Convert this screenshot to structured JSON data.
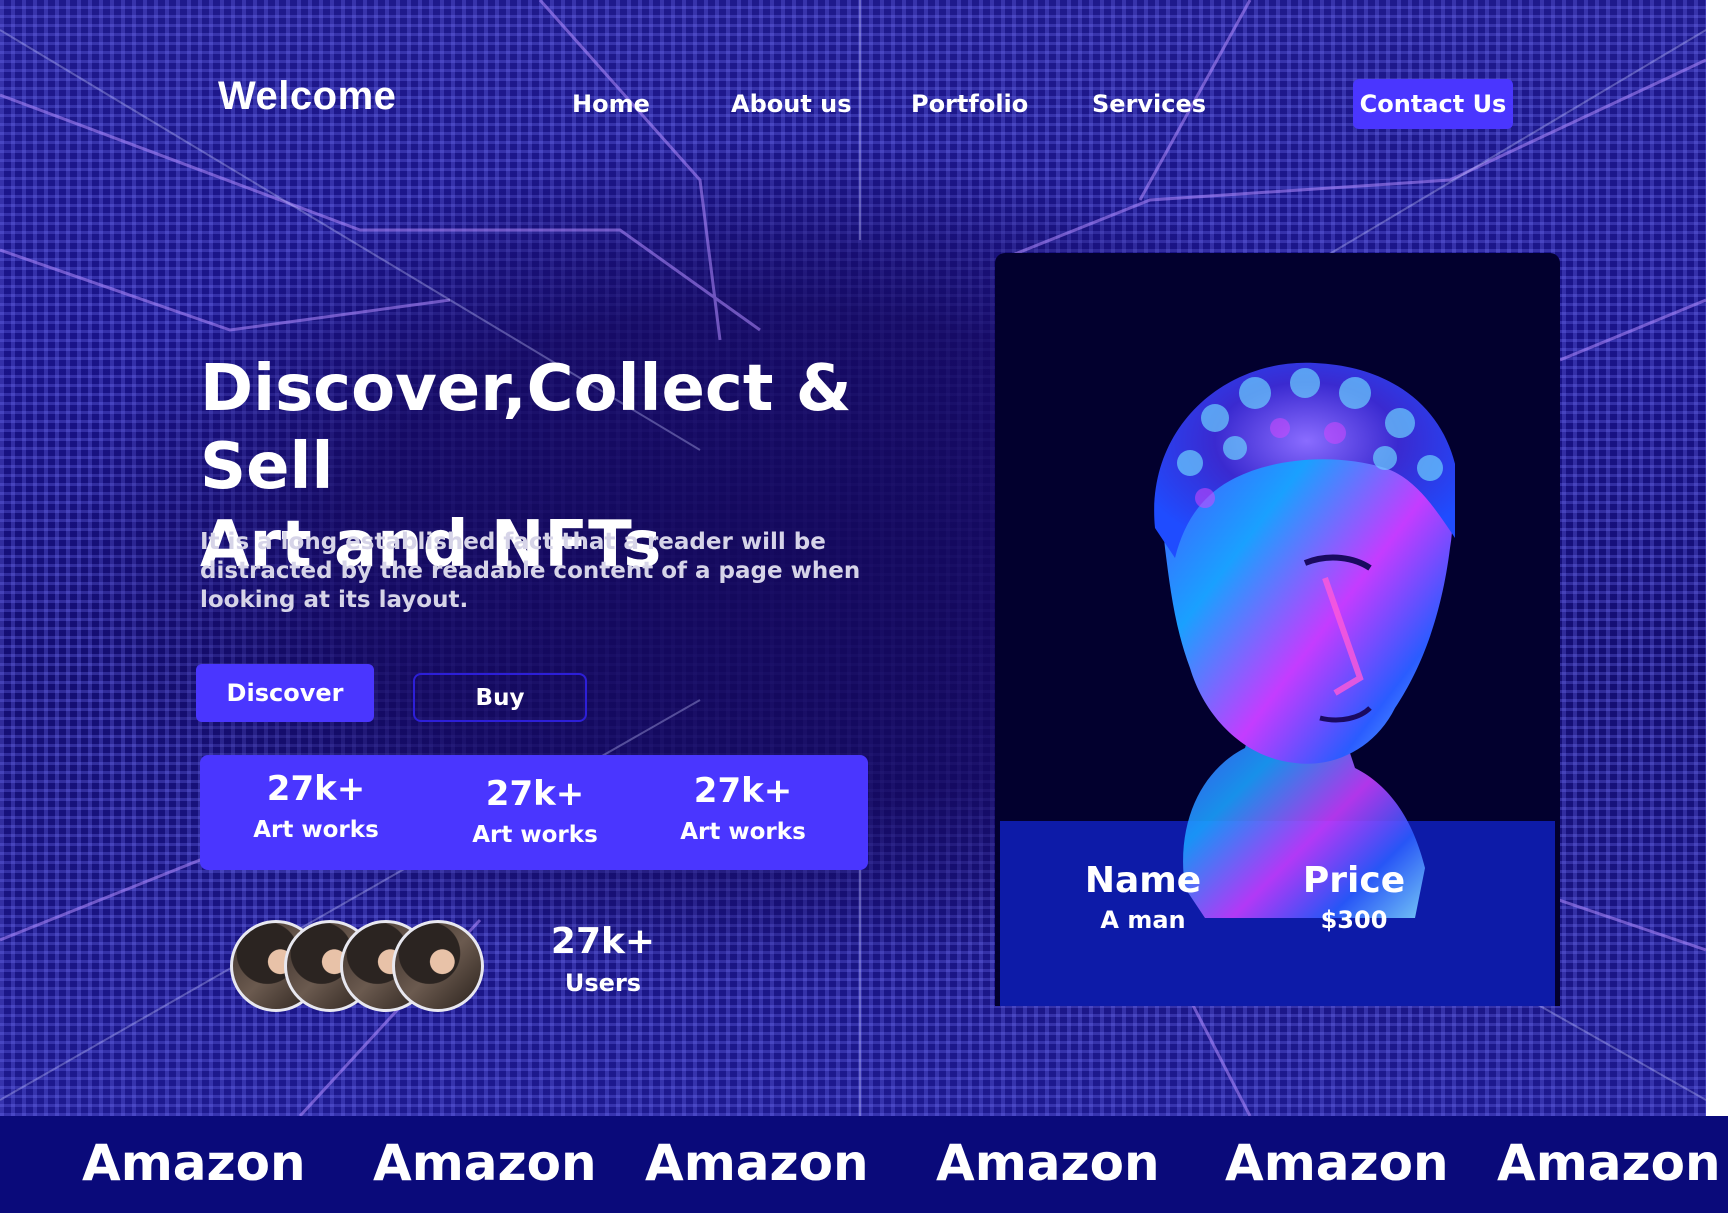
{
  "nav": {
    "logo": "Welcome",
    "links": [
      "Home",
      "About us",
      "Portfolio",
      "Services"
    ],
    "cta": "Contact Us"
  },
  "hero": {
    "headline_line1": "Discover,Collect & Sell",
    "headline_line2": "Art and NFTs",
    "subtext": "It is a long established fact that a reader will be distracted by the readable content of a page when looking at its layout.",
    "primary_button": "Discover",
    "secondary_button": "Buy"
  },
  "stats": [
    {
      "value": "27k+",
      "label": "Art works"
    },
    {
      "value": "27k+",
      "label": "Art works"
    },
    {
      "value": "27k+",
      "label": "Art works"
    }
  ],
  "users": {
    "value": "27k+",
    "label": "Users"
  },
  "card": {
    "name_heading": "Name",
    "name_value": "A man",
    "price_heading": "Price",
    "price_value": "$300"
  },
  "brands": [
    "Amazon",
    "Amazon",
    "Amazon",
    "Amazon",
    "Amazon",
    "Amazon"
  ],
  "colors": {
    "accent": "#4a36ff",
    "ticker_bg": "#0a0a7a",
    "card_bg": "#02002e",
    "card_info_bg": "#0d1ba8"
  }
}
